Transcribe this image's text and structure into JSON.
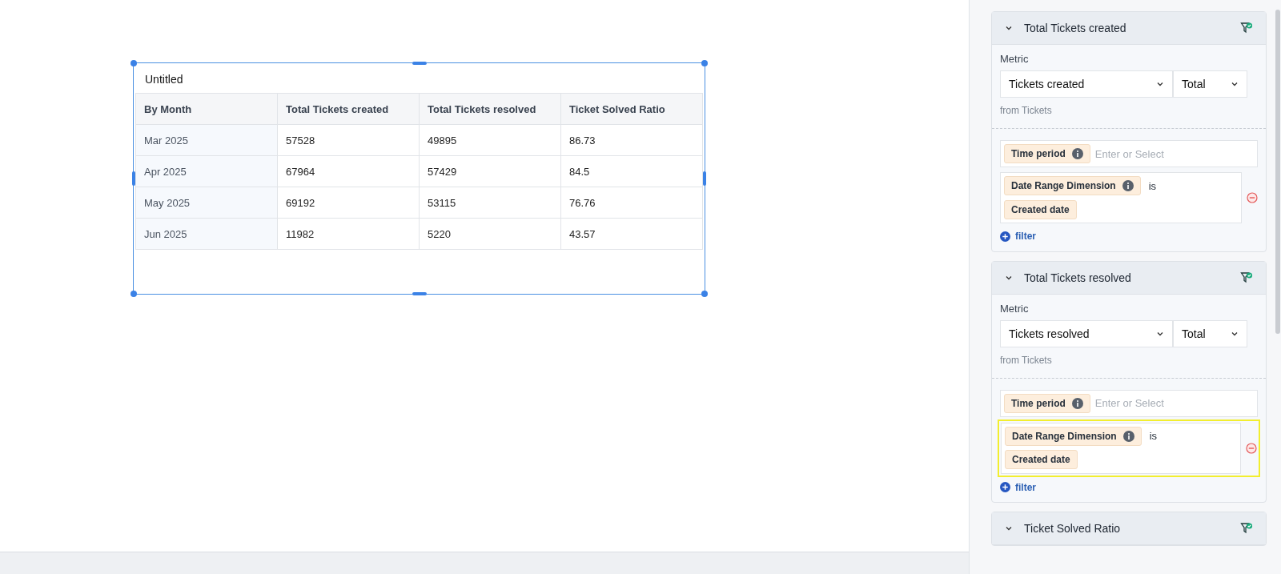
{
  "widget": {
    "title": "Untitled",
    "columns": [
      "By Month",
      "Total Tickets created",
      "Total Tickets resolved",
      "Ticket Solved Ratio"
    ],
    "rows": [
      [
        "Mar 2025",
        "57528",
        "49895",
        "86.73"
      ],
      [
        "Apr 2025",
        "67964",
        "57429",
        "84.5"
      ],
      [
        "May 2025",
        "69192",
        "53115",
        "76.76"
      ],
      [
        "Jun 2025",
        "11982",
        "5220",
        "43.57"
      ]
    ]
  },
  "metrics": [
    {
      "title": "Total Tickets created",
      "metric_label": "Metric",
      "metric": "Tickets created",
      "aggregation": "Total",
      "source": "from Tickets",
      "time_period": {
        "label": "Time period",
        "placeholder": "Enter or Select"
      },
      "conditions": [
        {
          "dimension": "Date Range Dimension",
          "operator": "is",
          "value": "Created date",
          "highlighted": false
        }
      ],
      "add_filter": "filter"
    },
    {
      "title": "Total Tickets resolved",
      "metric_label": "Metric",
      "metric": "Tickets resolved",
      "aggregation": "Total",
      "source": "from Tickets",
      "time_period": {
        "label": "Time period",
        "placeholder": "Enter or Select"
      },
      "conditions": [
        {
          "dimension": "Date Range Dimension",
          "operator": "is",
          "value": "Created date",
          "highlighted": true
        }
      ],
      "add_filter": "filter"
    },
    {
      "title": "Ticket Solved Ratio"
    }
  ]
}
